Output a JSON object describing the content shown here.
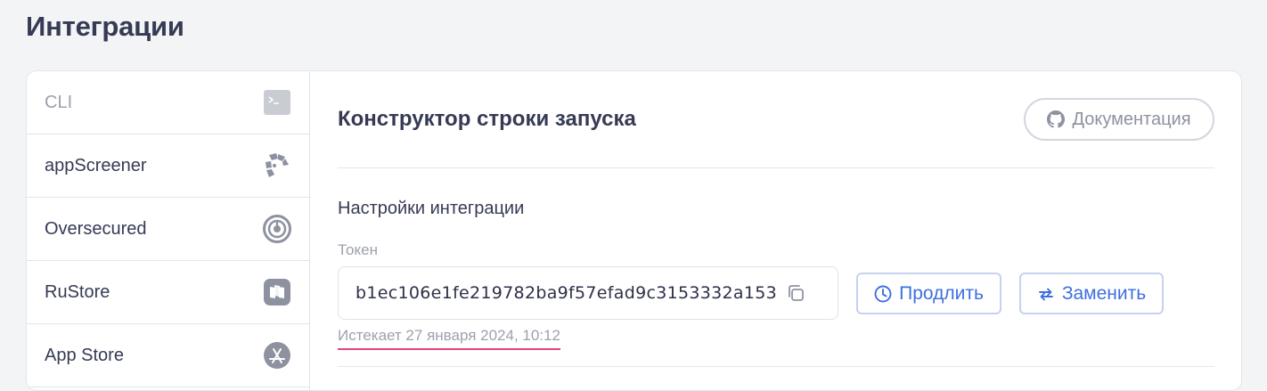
{
  "page": {
    "title": "Интеграции"
  },
  "sidebar": {
    "items": [
      {
        "label": "CLI",
        "icon": "terminal-icon",
        "muted": true
      },
      {
        "label": "appScreener",
        "icon": "appscreener-logo-icon",
        "muted": false
      },
      {
        "label": "Oversecured",
        "icon": "oversecured-logo-icon",
        "muted": false
      },
      {
        "label": "RuStore",
        "icon": "rustore-logo-icon",
        "muted": false
      },
      {
        "label": "App Store",
        "icon": "appstore-logo-icon",
        "muted": false
      }
    ]
  },
  "main": {
    "title": "Конструктор строки запуска",
    "docs_button": {
      "label": "Документация",
      "icon": "github-icon"
    },
    "settings": {
      "title": "Настройки интеграции",
      "token_label": "Токен",
      "token_value": "b1ec106e1fe219782ba9f57efad9c3153332a153",
      "copy_icon": "copy-icon",
      "extend_button": {
        "label": "Продлить",
        "icon": "clock-icon"
      },
      "replace_button": {
        "label": "Заменить",
        "icon": "swap-icon"
      },
      "expires_text": "Истекает 27 января 2024, 10:12"
    }
  },
  "colors": {
    "accent": "#3e6fe0",
    "muted_text": "#9da1ad",
    "underline": "#e0447d",
    "icon_gray": "#8e92a0"
  }
}
